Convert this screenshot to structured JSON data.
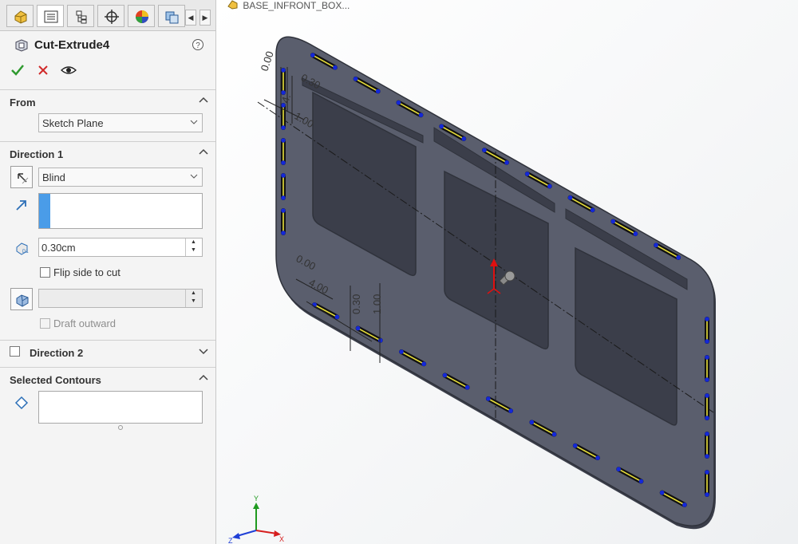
{
  "feature": {
    "title": "Cut-Extrude4"
  },
  "tabs": [
    {
      "icon": "feature-manager-icon"
    },
    {
      "icon": "property-manager-icon",
      "active": true
    },
    {
      "icon": "configuration-manager-icon"
    },
    {
      "icon": "dimxpert-manager-icon"
    },
    {
      "icon": "display-manager-icon"
    },
    {
      "icon": "cam-manager-icon"
    }
  ],
  "from": {
    "header": "From",
    "value": "Sketch Plane"
  },
  "direction1": {
    "header": "Direction 1",
    "end_condition": "Blind",
    "depth": "0.30cm",
    "flip_label": "Flip side to cut",
    "draft_label": "Draft outward"
  },
  "direction2": {
    "header": "Direction 2"
  },
  "contours": {
    "header": "Selected Contours"
  },
  "breadcrumb": {
    "text": "BASE_INFRONT_BOX..."
  },
  "dimensions": {
    "top_zero": "0.00",
    "top_030": "0.30",
    "top_4": "4.",
    "top_1": "1.00",
    "left_zero": "0.00",
    "left_400": "4.00",
    "left_030": "0.30",
    "left_100": "1.00"
  },
  "triad": {
    "x": "X",
    "y": "Y",
    "z": "Z"
  },
  "colors": {
    "plate": "#585c6b",
    "slot_yellow": "#e8df3a",
    "point_blue": "#1428d8",
    "accent": "#3d8fe0"
  }
}
